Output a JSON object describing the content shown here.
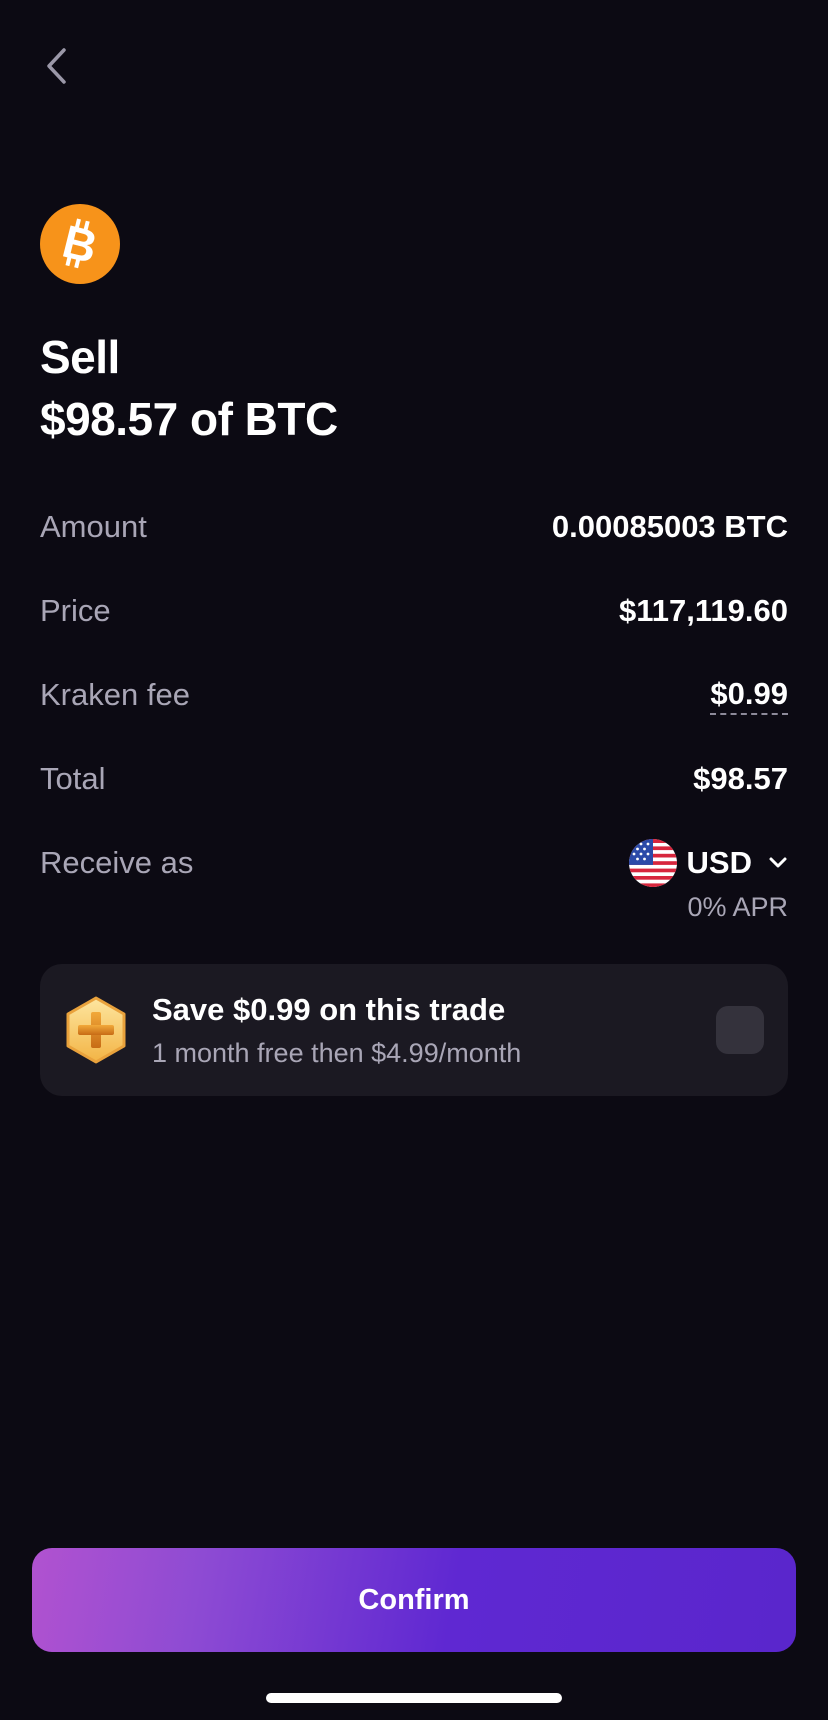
{
  "header": {
    "back_icon": "chevron-left-icon"
  },
  "asset": {
    "icon": "bitcoin-icon",
    "brand_color": "#f7931a"
  },
  "title": {
    "line1": "Sell",
    "line2": "$98.57 of BTC"
  },
  "details": {
    "amount": {
      "label": "Amount",
      "value": "0.00085003 BTC"
    },
    "price": {
      "label": "Price",
      "value": "$117,119.60"
    },
    "fee": {
      "label": "Kraken fee",
      "value": "$0.99"
    },
    "total": {
      "label": "Total",
      "value": "$98.57"
    },
    "receive": {
      "label": "Receive as",
      "currency": "USD",
      "flag_icon": "us-flag-icon",
      "apr": "0% APR"
    }
  },
  "promo": {
    "badge_icon": "kraken-plus-badge-icon",
    "title": "Save $0.99 on this trade",
    "subtitle": "1 month free then $4.99/month",
    "checked": false
  },
  "confirm": {
    "label": "Confirm",
    "accent": "#5f28d2"
  },
  "colors": {
    "background": "#0c0a13",
    "card": "#1b1922",
    "muted_text": "#a9a6b6"
  }
}
